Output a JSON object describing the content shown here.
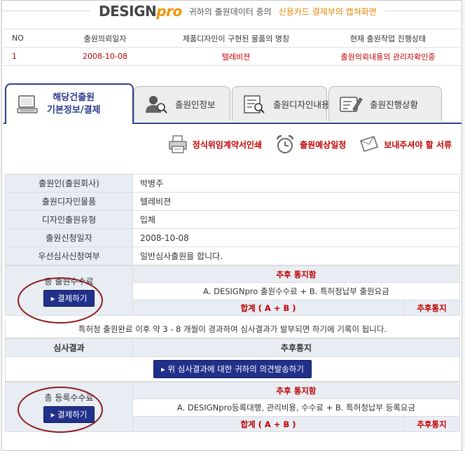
{
  "header": {
    "logo_main": "DESIGN",
    "logo_pro": "pro",
    "text": "귀하의 출원데이터 중의",
    "highlight": "신용카드 결제부의 캡쳐화면"
  },
  "status_table": {
    "headers": [
      "NO",
      "출원의뢰일자",
      "제품디자인이 구현된 물품의 명칭",
      "현재 출원작업 진행상태"
    ],
    "row": [
      "1",
      "2008-10-08",
      "텔레비젼",
      "출원의뢰내용의 관리자확인중"
    ]
  },
  "tabs": [
    {
      "line1": "해당건출원",
      "line2": "기본정보/결제",
      "icon": "computer-icon"
    },
    {
      "label": "출원인정보",
      "icon": "person-search-icon"
    },
    {
      "label": "출원디자인내용",
      "icon": "document-search-icon"
    },
    {
      "label": "출원진행상황",
      "icon": "document-edit-icon"
    }
  ],
  "actions": [
    {
      "label": "정식위임계약서인쇄",
      "icon": "printer-icon"
    },
    {
      "label": "출원예상일정",
      "icon": "alarm-clock-icon"
    },
    {
      "label": "보내주셔야 할 서류",
      "icon": "envelope-icon"
    }
  ],
  "info_rows": [
    {
      "key": "출원인(출원회사)",
      "value": "박병주"
    },
    {
      "key": "출원디자인물품",
      "value": "텔레비젼"
    },
    {
      "key": "디자인출원유형",
      "value": "입체"
    },
    {
      "key": "출원신청일자",
      "value": "2008-10-08"
    },
    {
      "key": "우선심사신청여부",
      "value": "일반심사출원을 합니다."
    }
  ],
  "filing_fee": {
    "title": "총 출원수수료",
    "pay_button": "▸ 결제하기",
    "notice": "추후 통지함",
    "desc": "A. DESIGNpro 출원수수료 + B. 특허청납부 출원요금",
    "total_label": "합계 ( A + B )",
    "total_value": "추후통지"
  },
  "note": "특허청 출원완료 이후 약 3 - 8 개월이 경과하여 심사결과가 발부되면 하기에 기록이 됩니다.",
  "exam": {
    "key": "심사결과",
    "value": "추후통지",
    "opinion_button": "▸ 위 심사결과에 대한 귀하의 의견발송하기"
  },
  "registration_fee": {
    "title": "총 등록수수료",
    "pay_button": "▸ 결제하기",
    "notice": "추후 통지함",
    "desc": "A. DESIGNpro등록대행, 관리비용, 수수료 + B. 특허청납부 등록요금",
    "total_label": "합계 ( A + B )",
    "total_value": "추후통지"
  },
  "colors": {
    "accent_red": "#c00000",
    "brand_navy": "#21308a",
    "brand_orange": "#f29400",
    "label_bg": "#e8edf4"
  }
}
